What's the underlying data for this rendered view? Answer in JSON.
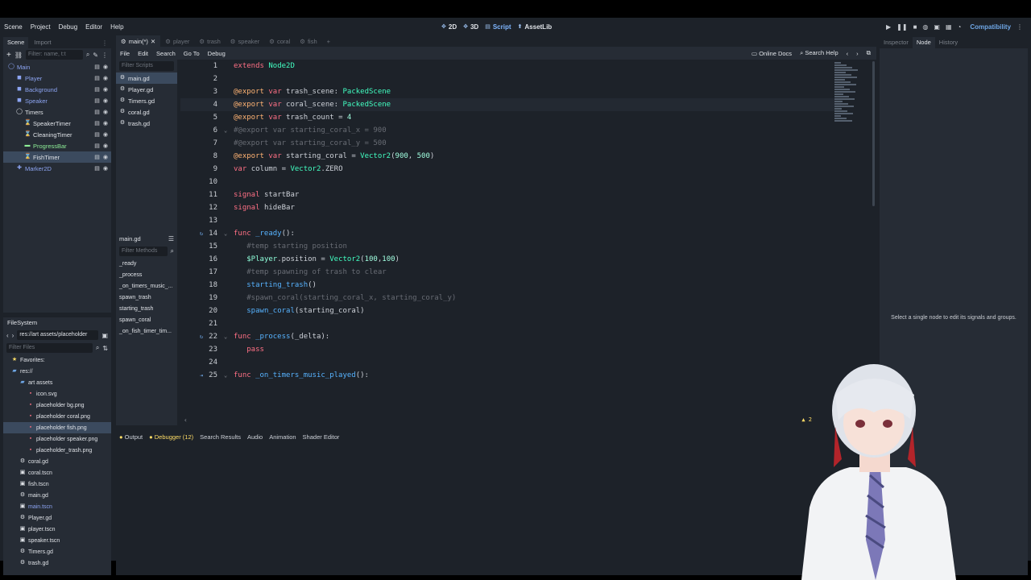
{
  "menubar": {
    "items": [
      "Scene",
      "Project",
      "Debug",
      "Editor",
      "Help"
    ],
    "main_screens": [
      {
        "label": "2D",
        "icon": "2d-icon"
      },
      {
        "label": "3D",
        "icon": "3d-icon"
      },
      {
        "label": "Script",
        "icon": "script-icon"
      },
      {
        "label": "AssetLib",
        "icon": "assetlib-icon"
      }
    ],
    "renderer": "Compatibility"
  },
  "scene_dock": {
    "tabs": [
      "Scene",
      "Import"
    ],
    "filter_placeholder": "Filter: name, t:t",
    "nodes": [
      {
        "label": "Main",
        "icon": "node2d-icon",
        "indent": 0,
        "color": "#8da5f3"
      },
      {
        "label": "Player",
        "icon": "sprite-icon",
        "indent": 1,
        "color": "#8da5f3"
      },
      {
        "label": "Background",
        "icon": "sprite-icon",
        "indent": 1,
        "color": "#8da5f3"
      },
      {
        "label": "Speaker",
        "icon": "sprite-icon",
        "indent": 1,
        "color": "#8da5f3"
      },
      {
        "label": "Timers",
        "icon": "node-icon",
        "indent": 1,
        "color": "#dfe2e7"
      },
      {
        "label": "SpeakerTimer",
        "icon": "timer-icon",
        "indent": 2,
        "color": "#dfe2e7"
      },
      {
        "label": "CleaningTimer",
        "icon": "timer-icon",
        "indent": 2,
        "color": "#dfe2e7"
      },
      {
        "label": "ProgressBar",
        "icon": "progressbar-icon",
        "indent": 2,
        "color": "#8eef97"
      },
      {
        "label": "FishTimer",
        "icon": "timer-icon",
        "indent": 2,
        "color": "#dfe2e7"
      },
      {
        "label": "Marker2D",
        "icon": "marker-icon",
        "indent": 1,
        "color": "#8da5f3"
      }
    ]
  },
  "filesystem": {
    "title": "FileSystem",
    "path": "res://art assets/placeholder",
    "filter_placeholder": "Filter Files",
    "items": [
      {
        "label": "Favorites:",
        "icon": "star-icon",
        "indent": 0
      },
      {
        "label": "res://",
        "icon": "folder-icon",
        "indent": 0
      },
      {
        "label": "art assets",
        "icon": "folder-icon",
        "indent": 1
      },
      {
        "label": "icon.svg",
        "icon": "image-icon",
        "indent": 2
      },
      {
        "label": "placeholder bg.png",
        "icon": "image-icon",
        "indent": 2
      },
      {
        "label": "placeholder coral.png",
        "icon": "image-icon",
        "indent": 2
      },
      {
        "label": "placeholder fish.png",
        "icon": "image-icon",
        "indent": 2
      },
      {
        "label": "placeholder speaker.png",
        "icon": "image-icon",
        "indent": 2
      },
      {
        "label": "placeholder_trash.png",
        "icon": "image-icon",
        "indent": 2
      },
      {
        "label": "coral.gd",
        "icon": "gear-icon",
        "indent": 1
      },
      {
        "label": "coral.tscn",
        "icon": "scene-icon",
        "indent": 1
      },
      {
        "label": "fish.tscn",
        "icon": "scene-icon",
        "indent": 1
      },
      {
        "label": "main.gd",
        "icon": "gear-icon",
        "indent": 1
      },
      {
        "label": "main.tscn",
        "icon": "scene-icon",
        "indent": 1
      },
      {
        "label": "Player.gd",
        "icon": "gear-icon",
        "indent": 1
      },
      {
        "label": "player.tscn",
        "icon": "scene-icon",
        "indent": 1
      },
      {
        "label": "speaker.tscn",
        "icon": "scene-icon",
        "indent": 1
      },
      {
        "label": "Timers.gd",
        "icon": "gear-icon",
        "indent": 1
      },
      {
        "label": "trash.gd",
        "icon": "gear-icon",
        "indent": 1
      }
    ]
  },
  "script_tabs": [
    "main(*)",
    "player",
    "trash",
    "speaker",
    "coral",
    "fish"
  ],
  "script_menu": [
    "File",
    "Edit",
    "Search",
    "Go To",
    "Debug"
  ],
  "script_menu_right": [
    "Online Docs",
    "Search Help"
  ],
  "script_list": {
    "filter_placeholder": "Filter Scripts",
    "scripts": [
      "main.gd",
      "Player.gd",
      "Timers.gd",
      "coral.gd",
      "trash.gd"
    ],
    "current": "main.gd",
    "methods_placeholder": "Filter Methods",
    "methods": [
      "_ready",
      "_process",
      "_on_timers_music_...",
      "spawn_trash",
      "starting_trash",
      "spawn_coral",
      "_on_fish_timer_tim..."
    ]
  },
  "code_lines": [
    {
      "n": "1",
      "segs": [
        [
          "kw",
          "extends "
        ],
        [
          "ty",
          "Node2D"
        ]
      ]
    },
    {
      "n": "2",
      "segs": []
    },
    {
      "n": "3",
      "segs": [
        [
          "ann",
          "@export "
        ],
        [
          "kw",
          "var "
        ],
        [
          "pl",
          "trash_scene: "
        ],
        [
          "ty",
          "PackedScene"
        ]
      ]
    },
    {
      "n": "4",
      "segs": [
        [
          "ann",
          "@export "
        ],
        [
          "kw",
          "var "
        ],
        [
          "pl",
          "coral_scene: "
        ],
        [
          "ty",
          "PackedScene"
        ]
      ]
    },
    {
      "n": "5",
      "segs": [
        [
          "ann",
          "@export "
        ],
        [
          "kw",
          "var "
        ],
        [
          "pl",
          "trash_count = "
        ],
        [
          "num",
          "4"
        ]
      ]
    },
    {
      "n": "6",
      "segs": [
        [
          "cm",
          "#@export var starting_coral_x = 900"
        ]
      ]
    },
    {
      "n": "7",
      "segs": [
        [
          "cm",
          "#@export var starting_coral_y = 500"
        ]
      ]
    },
    {
      "n": "8",
      "segs": [
        [
          "ann",
          "@export "
        ],
        [
          "kw",
          "var "
        ],
        [
          "pl",
          "starting_coral = "
        ],
        [
          "ty",
          "Vector2"
        ],
        [
          "pl",
          "("
        ],
        [
          "num",
          "900"
        ],
        [
          "pl",
          ", "
        ],
        [
          "num",
          "500"
        ],
        [
          "pl",
          ")"
        ]
      ]
    },
    {
      "n": "9",
      "segs": [
        [
          "kw",
          "var "
        ],
        [
          "pl",
          "column = "
        ],
        [
          "ty",
          "Vector2"
        ],
        [
          "pl",
          ".ZERO"
        ]
      ]
    },
    {
      "n": "10",
      "segs": []
    },
    {
      "n": "11",
      "segs": [
        [
          "kw",
          "signal "
        ],
        [
          "pl",
          "startBar"
        ]
      ]
    },
    {
      "n": "12",
      "segs": [
        [
          "kw",
          "signal "
        ],
        [
          "pl",
          "hideBar"
        ]
      ]
    },
    {
      "n": "13",
      "segs": []
    },
    {
      "n": "14",
      "segs": [
        [
          "kw",
          "func "
        ],
        [
          "fn",
          "_ready"
        ],
        [
          "pl",
          "():"
        ]
      ]
    },
    {
      "n": "15",
      "segs": [
        [
          "pl",
          "   "
        ],
        [
          "cm",
          "#temp starting position"
        ]
      ]
    },
    {
      "n": "16",
      "segs": [
        [
          "pl",
          "   "
        ],
        [
          "nd",
          "$Player"
        ],
        [
          "pl",
          ".position = "
        ],
        [
          "ty",
          "Vector2"
        ],
        [
          "pl",
          "("
        ],
        [
          "num",
          "100"
        ],
        [
          "pl",
          ","
        ],
        [
          "num",
          "100"
        ],
        [
          "pl",
          ")"
        ]
      ]
    },
    {
      "n": "17",
      "segs": [
        [
          "pl",
          "   "
        ],
        [
          "cm",
          "#temp spawning of trash to clear"
        ]
      ]
    },
    {
      "n": "18",
      "segs": [
        [
          "pl",
          "   "
        ],
        [
          "fn",
          "starting_trash"
        ],
        [
          "pl",
          "()"
        ]
      ]
    },
    {
      "n": "19",
      "segs": [
        [
          "pl",
          "   "
        ],
        [
          "cm",
          "#spawn_coral(starting_coral_x, starting_coral_y)"
        ]
      ]
    },
    {
      "n": "20",
      "segs": [
        [
          "pl",
          "   "
        ],
        [
          "fn",
          "spawn_coral"
        ],
        [
          "pl",
          "(starting_coral)"
        ]
      ]
    },
    {
      "n": "21",
      "segs": []
    },
    {
      "n": "22",
      "segs": [
        [
          "kw",
          "func "
        ],
        [
          "fn",
          "_process"
        ],
        [
          "pl",
          "(_delta):"
        ]
      ]
    },
    {
      "n": "23",
      "segs": [
        [
          "pl",
          "   "
        ],
        [
          "kw",
          "pass"
        ]
      ]
    },
    {
      "n": "24",
      "segs": []
    },
    {
      "n": "25",
      "segs": [
        [
          "kw",
          "func "
        ],
        [
          "fn",
          "_on_timers_music_played"
        ],
        [
          "pl",
          "():"
        ]
      ]
    }
  ],
  "status": {
    "warnings": "2"
  },
  "bottom_tabs": [
    "Output",
    "Debugger (12)",
    "Search Results",
    "Audio",
    "Animation",
    "Shader Editor"
  ],
  "right_dock": {
    "tabs": [
      "Inspector",
      "Node",
      "History"
    ],
    "message": "Select a single node to edit its signals and groups."
  }
}
